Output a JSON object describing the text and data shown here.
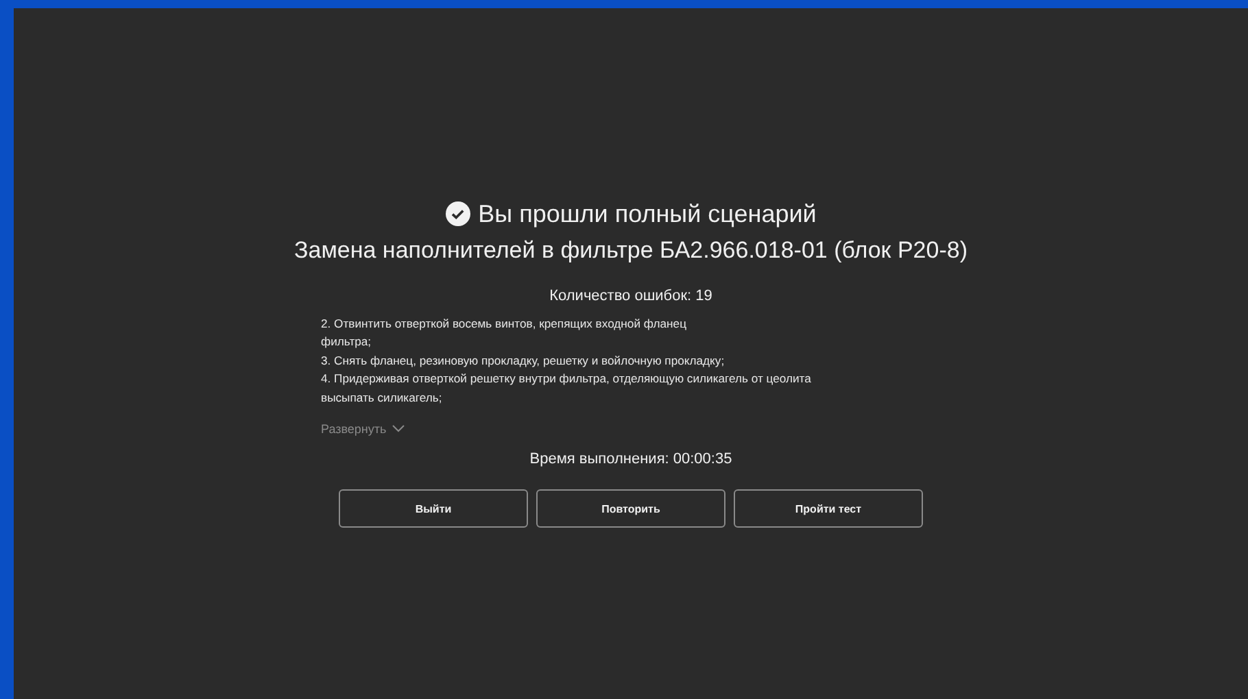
{
  "result": {
    "passed": true,
    "title": "Вы прошли полный сценарий",
    "scenario": "Замена наполнителей в фильтре БА2.966.018-01 (блок Р20-8)"
  },
  "errors": "Количество ошибок: 19",
  "steps": [
    "2. Отвинтить отверткой восемь винтов, крепящих входной фланец",
    "фильтра;",
    "3. Снять фланец, резиновую прокладку, решетку и войлочную прокладку;",
    "4. Придерживая отверткой решетку внутри фильтра, отделяющую силикагель от цеолита",
    "высыпать силикагель;"
  ],
  "expand": {
    "label": "Развернуть",
    "expanded": false
  },
  "time": "Время выполнения: 00:00:35",
  "buttons": [
    "Выйти",
    "Повторить",
    "Пройти тест"
  ]
}
